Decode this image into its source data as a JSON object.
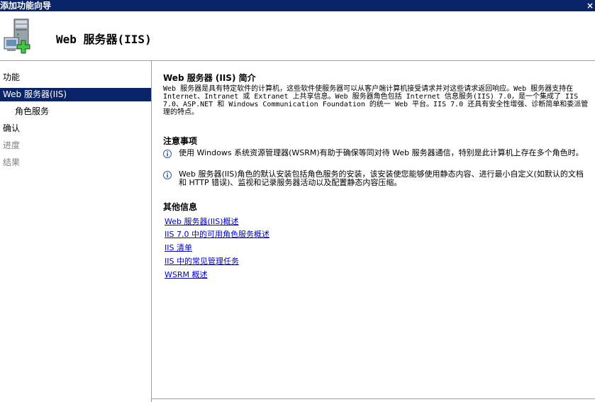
{
  "window": {
    "title": "添加功能向导",
    "close_label": "×"
  },
  "header": {
    "title": "Web 服务器(IIS)",
    "icon": "server-add-icon"
  },
  "sidebar": {
    "items": [
      {
        "label": "功能",
        "state": "normal"
      },
      {
        "label": "Web 服务器(IIS)",
        "state": "active"
      },
      {
        "label": "角色服务",
        "state": "normal"
      },
      {
        "label": "确认",
        "state": "normal"
      },
      {
        "label": "进度",
        "state": "disabled"
      },
      {
        "label": "结果",
        "state": "disabled"
      }
    ]
  },
  "content": {
    "intro_heading": "Web 服务器 (IIS) 简介",
    "intro_text": "Web 服务器是具有特定软件的计算机，这些软件使服务器可以从客户端计算机接受请求并对这些请求返回响应。Web 服务器支持在 Internet、Intranet 或 Extranet 上共享信息。Web 服务器角色包括 Internet 信息服务(IIS) 7.0，是一个集成了 IIS 7.0、ASP.NET 和 Windows Communication Foundation 的统一 Web 平台。IIS 7.0 还具有安全性增强、诊断简单和委派管理的特点。",
    "notes_heading": "注意事项",
    "notes": [
      {
        "icon": "info-icon",
        "text": "使用 Windows 系统资源管理器(WSRM)有助于确保等同对待 Web 服务器通信，特别是此计算机上存在多个角色时。"
      },
      {
        "icon": "info-icon",
        "text": "Web 服务器(IIS)角色的默认安装包括角色服务的安装，该安装使您能够使用静态内容、进行最小自定义(如默认的文档和 HTTP 错误)、监视和记录服务器活动以及配置静态内容压缩。"
      }
    ],
    "more_heading": "其他信息",
    "links": [
      "Web 服务器(IIS)概述",
      "IIS 7.0 中的可用角色服务概述",
      "IIS 清单",
      "IIS 中的常见管理任务",
      "WSRM 概述"
    ]
  },
  "colors": {
    "title_bar": "#0a246a",
    "selected": "#0a246a",
    "link": "#0000c8",
    "disabled": "#808080"
  }
}
